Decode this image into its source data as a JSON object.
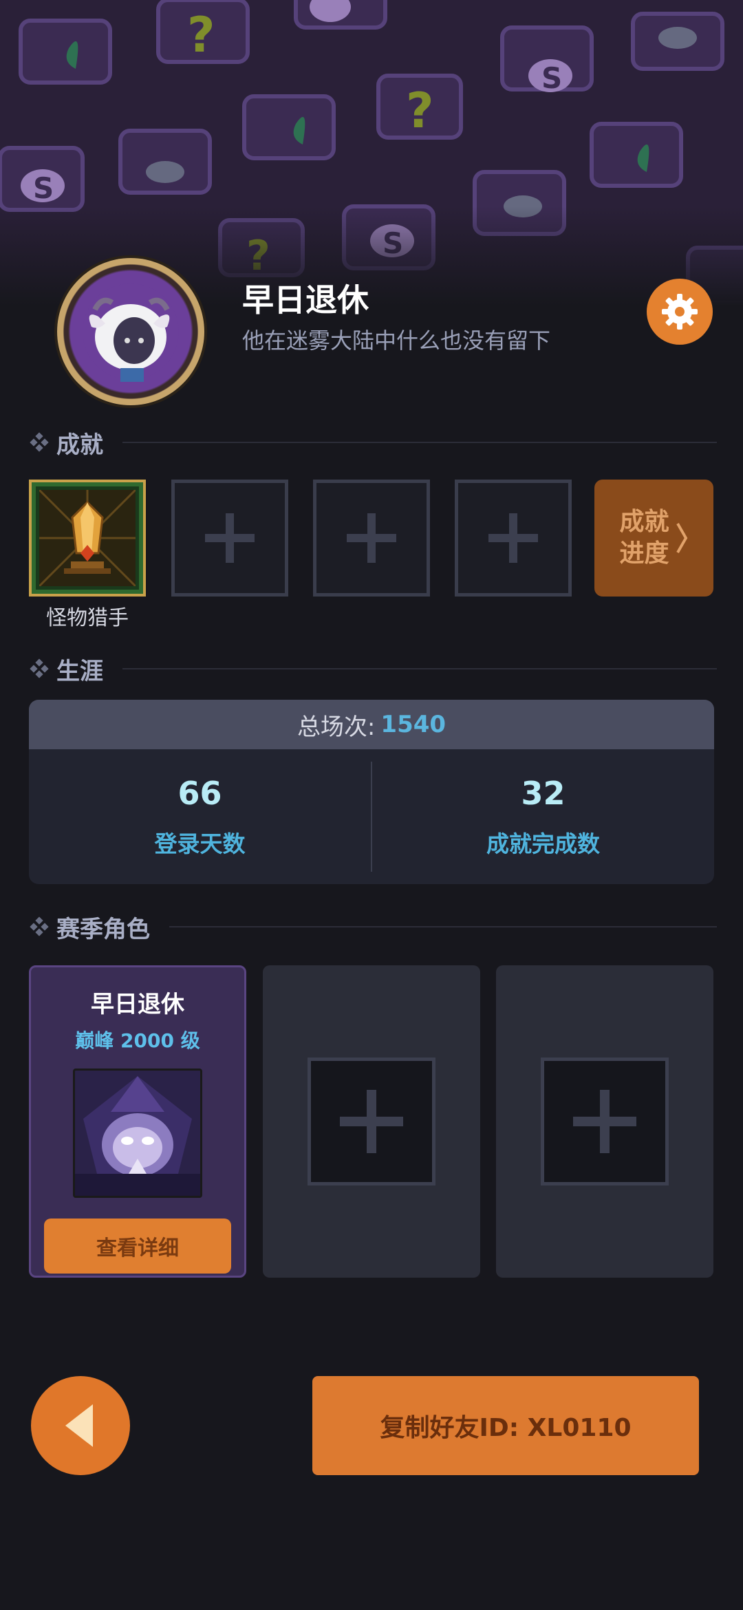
{
  "profile": {
    "name": "早日退休",
    "motto": "他在迷雾大陆中什么也没有留下"
  },
  "achievements": {
    "section_title": "成就",
    "unlocked": [
      {
        "label": "怪物猎手",
        "icon": "golden-crystal-trophy-icon"
      }
    ],
    "empty_slots": 3,
    "progress_label": "成就\n进度"
  },
  "career": {
    "section_title": "生涯",
    "total_label": "总场次:",
    "total_value": "1540",
    "stats": [
      {
        "value": "66",
        "label": "登录天数"
      },
      {
        "value": "32",
        "label": "成就完成数"
      }
    ]
  },
  "season": {
    "section_title": "赛季角色",
    "roles": [
      {
        "name": "早日退休",
        "level": "巅峰 2000 级",
        "button": "查看详细",
        "portrait": "hooded-mage-icon"
      }
    ],
    "empty_slots": 2
  },
  "footer": {
    "copy_button": "复制好友ID: XL0110"
  },
  "colors": {
    "accent_orange": "#e07f30",
    "stat_blue": "#4fb4de",
    "background": "#17171d"
  }
}
